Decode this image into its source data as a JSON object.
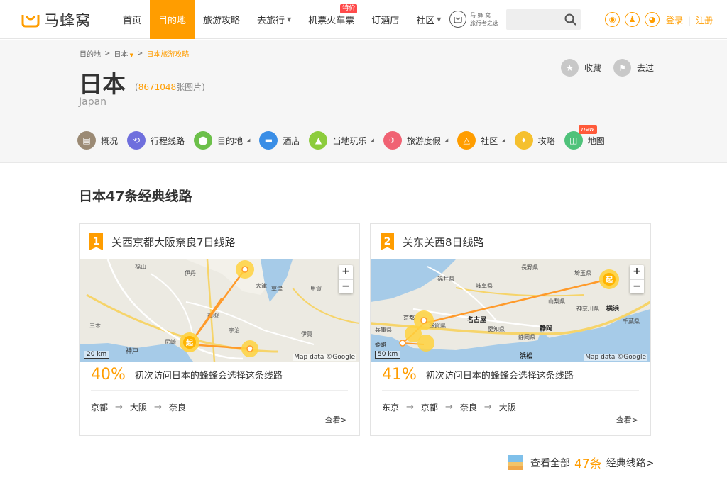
{
  "nav": {
    "logo_text": "马蜂窝",
    "items": [
      {
        "label": "首页"
      },
      {
        "label": "目的地"
      },
      {
        "label": "旅游攻略"
      },
      {
        "label": "去旅行"
      },
      {
        "label": "机票火车票",
        "badge": "特价"
      },
      {
        "label": "订酒店"
      },
      {
        "label": "社区"
      }
    ],
    "brand_line1": "马 蜂 窝",
    "brand_line2": "旅行者之选",
    "search_placeholder": "",
    "login": "登录",
    "register": "注册",
    "social_icons": [
      "weibo-icon",
      "qq-icon",
      "wechat-icon"
    ],
    "accent_color": "#ff9d00"
  },
  "breadcrumb": {
    "root": "目的地",
    "country": "日本",
    "current": "日本旅游攻略"
  },
  "country": {
    "name": "日本",
    "photo_count": "8671048",
    "photo_suffix": "张图片",
    "english": "Japan"
  },
  "actions": {
    "favorite": "收藏",
    "been": "去过"
  },
  "subnav": [
    {
      "label": "概况",
      "icon": "overview-icon",
      "color": "#9b8a74",
      "dropdown": false
    },
    {
      "label": "行程线路",
      "icon": "route-icon",
      "color": "#6f6fdd",
      "dropdown": false
    },
    {
      "label": "目的地",
      "icon": "location-pin-icon",
      "color": "#6cc04a",
      "dropdown": true
    },
    {
      "label": "酒店",
      "icon": "bed-icon",
      "color": "#3a8ee6",
      "dropdown": false
    },
    {
      "label": "当地玩乐",
      "icon": "mountain-icon",
      "color": "#8ccc3c",
      "dropdown": true
    },
    {
      "label": "旅游度假",
      "icon": "plane-icon",
      "color": "#f06273",
      "dropdown": true
    },
    {
      "label": "社区",
      "icon": "community-icon",
      "color": "#ff9d00",
      "dropdown": true
    },
    {
      "label": "攻略",
      "icon": "compass-icon",
      "color": "#f5c02e",
      "dropdown": false
    },
    {
      "label": "地图",
      "icon": "map-icon",
      "color": "#4fc27a",
      "dropdown": false,
      "badge": "new"
    }
  ],
  "section": {
    "title": "日本47条经典线路"
  },
  "routes": [
    {
      "rank": "1",
      "title": "关西京都大阪奈良7日线路",
      "percent": "40%",
      "desc": "初次访问日本的蜂蜂会选择这条线路",
      "stops": [
        "京都",
        "大阪",
        "奈良"
      ],
      "map_scale": "20 km",
      "map_attribution": "Map data ©Google",
      "start_marker": "起",
      "map_labels": [
        "福山",
        "伊丹",
        "大津",
        "草津",
        "甲賀",
        "三木",
        "高槻",
        "宇治",
        "伊賀",
        "尼崎",
        "神戸"
      ],
      "view": "查看>"
    },
    {
      "rank": "2",
      "title": "关东关西8日线路",
      "percent": "41%",
      "desc": "初次访问日本的蜂蜂会选择这条线路",
      "stops": [
        "东京",
        "京都",
        "奈良",
        "大阪"
      ],
      "map_scale": "50 km",
      "map_attribution": "Map data ©Google",
      "start_marker": "起",
      "map_labels": [
        "長野県",
        "福井県",
        "岐阜県",
        "埼玉県",
        "山梨県",
        "京都",
        "滋賀県",
        "名古屋",
        "愛知県",
        "神奈川県",
        "横浜",
        "兵庫県",
        "静岡県",
        "静岡",
        "千葉県",
        "姫路",
        "浜松"
      ],
      "view": "查看>"
    }
  ],
  "view_all": {
    "prefix": "查看全部",
    "count": "47条",
    "suffix": "经典线路>"
  },
  "map_zoom": {
    "plus": "+",
    "minus": "−"
  }
}
